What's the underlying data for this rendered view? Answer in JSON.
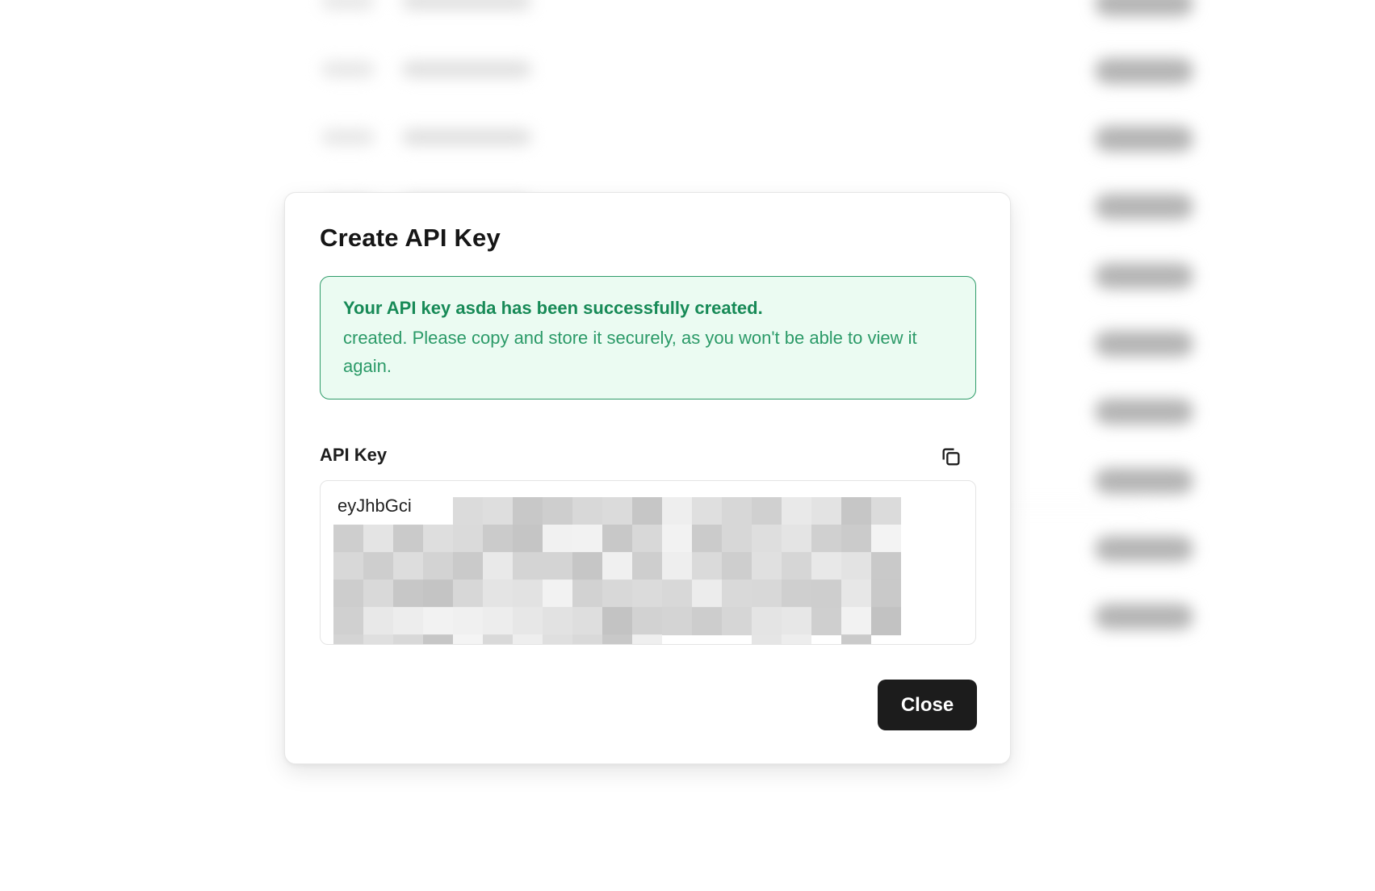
{
  "dialog": {
    "title": "Create API Key",
    "alert": {
      "prefix": "Your API key ",
      "key_name": "asda",
      "suffix": " has been successfully created.",
      "body": "created. Please copy and store it securely, as you won't be able to view it again."
    },
    "field_label": "API Key",
    "key_value_visible": "eyJhbGci",
    "copy_icon": "copy-icon",
    "close_label": "Close"
  },
  "colors": {
    "alert_bg": "#ebfbf2",
    "alert_border": "#2e9b69",
    "alert_text": "#178a57",
    "button_bg": "#1c1c1c"
  }
}
